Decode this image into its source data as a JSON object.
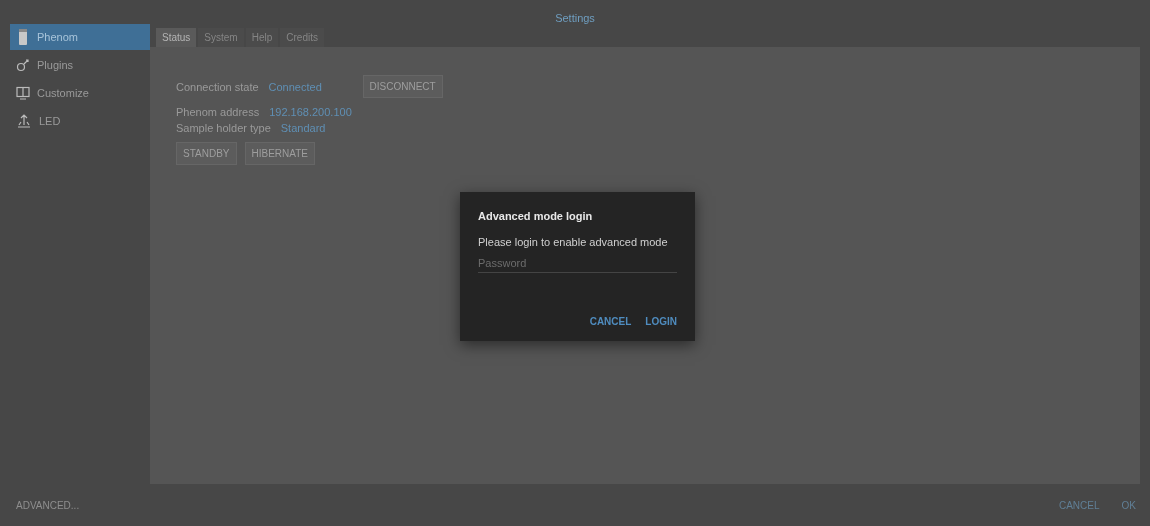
{
  "window": {
    "title": "Settings"
  },
  "sidebar": {
    "items": [
      {
        "label": "Phenom",
        "selected": true
      },
      {
        "label": "Plugins",
        "selected": false
      },
      {
        "label": "Customize",
        "selected": false
      },
      {
        "label": "LED",
        "selected": false
      }
    ]
  },
  "tabs": [
    {
      "label": "Status",
      "selected": true
    },
    {
      "label": "System",
      "selected": false
    },
    {
      "label": "Help",
      "selected": false
    },
    {
      "label": "Credits",
      "selected": false
    }
  ],
  "status": {
    "connection_label": "Connection state",
    "connection_value": "Connected",
    "disconnect_button": "DISCONNECT",
    "address_label": "Phenom address",
    "address_value": "192.168.200.100",
    "holder_label": "Sample holder type",
    "holder_value": "Standard",
    "buttons": [
      "STANDBY",
      "HIBERNATE"
    ]
  },
  "dialog": {
    "title": "Advanced mode login",
    "message": "Please login to enable advanced mode",
    "password": {
      "placeholder": "Password"
    },
    "buttons": [
      "CANCEL",
      "LOGIN"
    ]
  },
  "footer": {
    "advanced_button": "ADVANCED...",
    "buttons": [
      "CANCEL",
      "OK"
    ]
  }
}
